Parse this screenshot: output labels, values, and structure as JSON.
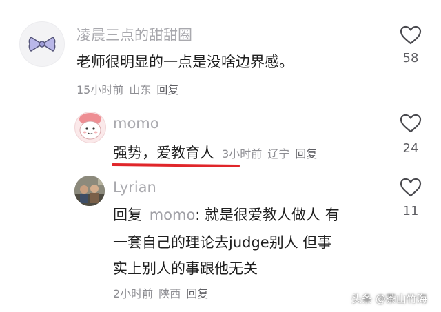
{
  "comments": [
    {
      "username": "凌晨三点的甜甜圈",
      "text": "老师很明显的一点是没啥边界感。",
      "time": "15小时前",
      "location": "山东",
      "reply_label": "回复",
      "likes": "58",
      "avatar_icon": "bow-icon"
    },
    {
      "username": "momo",
      "text": "强势，爱教育人",
      "time": "3小时前",
      "location": "辽宁",
      "reply_label": "回复",
      "likes": "24",
      "avatar_icon": "cartoon-face-avatar",
      "underline_color": "#e0262a"
    },
    {
      "username": "Lyrian",
      "reply_prefix": "回复",
      "mention": "momo",
      "text_line1": ": 就是很爱教人做人 有",
      "text_line2": "一套自己的理论去judge别人 但事",
      "text_line3": "实上别人的事跟他无关",
      "time": "2小时前",
      "location": "陕西",
      "reply_label": "回复",
      "likes": "11",
      "avatar_icon": "photo-avatar"
    }
  ],
  "watermark": "头条 @茶山竹海",
  "colors": {
    "username": "#a9a9ae",
    "body_text": "#1f1f1f",
    "meta": "#8e8e93",
    "heart_outline": "#4a4a4f",
    "highlight_underline": "#e0262a"
  }
}
